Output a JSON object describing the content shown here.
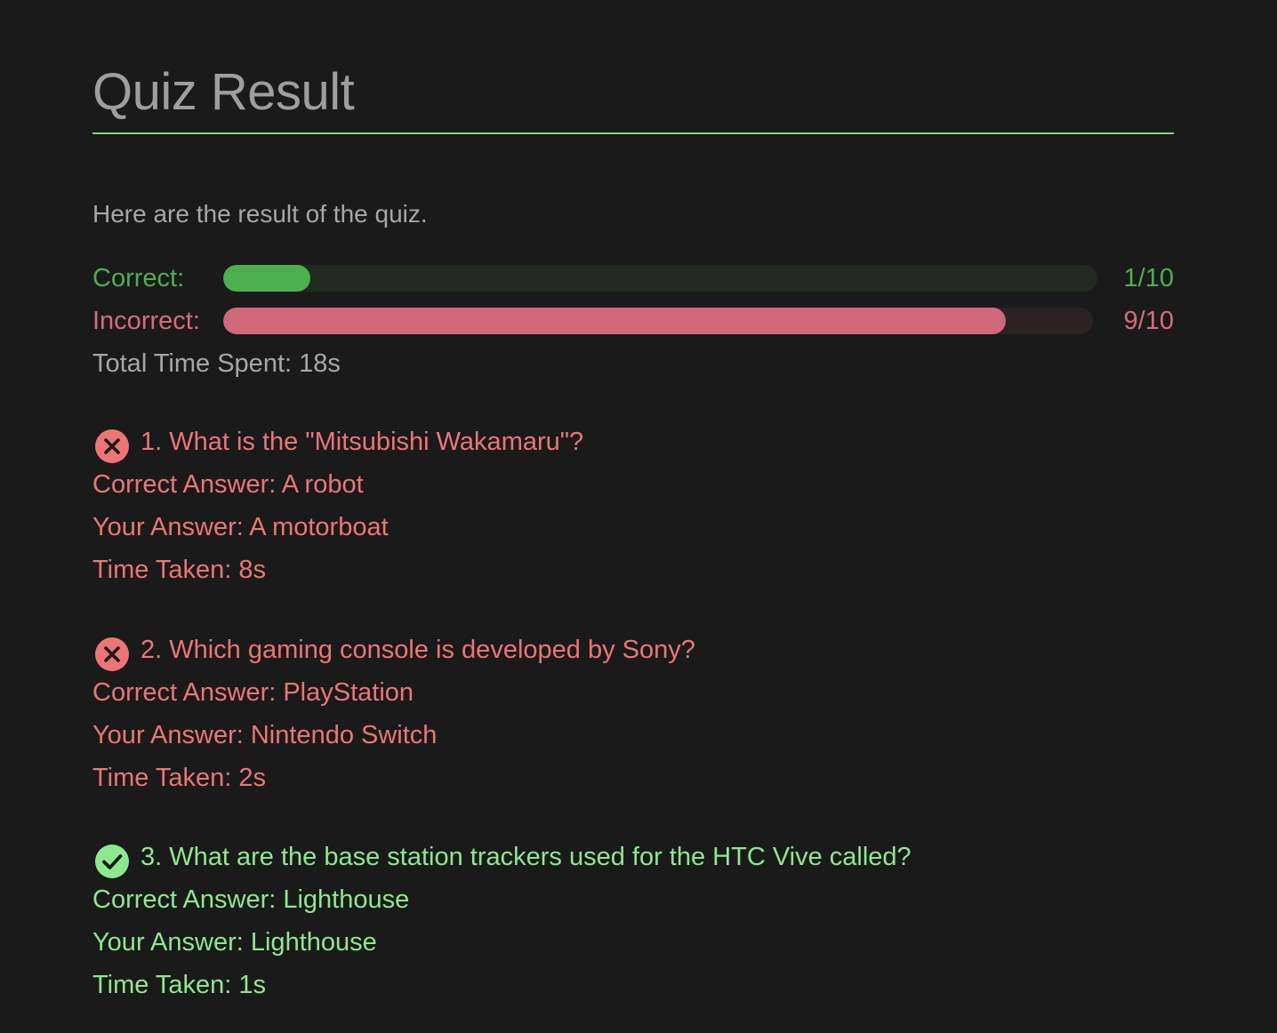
{
  "page": {
    "title": "Quiz Result",
    "intro": "Here are the result of the quiz."
  },
  "stats": {
    "correct": {
      "label": "Correct:",
      "display": "1/10",
      "fraction": 0.1,
      "color": "#4caf50"
    },
    "incorrect": {
      "label": "Incorrect:",
      "display": "9/10",
      "fraction": 0.9,
      "color": "#d0687a"
    },
    "total_time": "Total Time Spent: 18s"
  },
  "questions": [
    {
      "status": "incorrect",
      "icon": "x-circle-icon",
      "question": "1. What is the \"Mitsubishi Wakamaru\"?",
      "correct_answer": "Correct Answer: A robot",
      "your_answer": "Your Answer: A motorboat",
      "time_taken": "Time Taken: 8s"
    },
    {
      "status": "incorrect",
      "icon": "x-circle-icon",
      "question": "2. Which gaming console is developed by Sony?",
      "correct_answer": "Correct Answer: PlayStation",
      "your_answer": "Your Answer: Nintendo Switch",
      "time_taken": "Time Taken: 2s"
    },
    {
      "status": "correct",
      "icon": "check-circle-icon",
      "question": "3. What are the base station trackers used for the HTC Vive called?",
      "correct_answer": "Correct Answer: Lighthouse",
      "your_answer": "Your Answer: Lighthouse",
      "time_taken": "Time Taken: 1s"
    }
  ],
  "colors": {
    "background": "#1a1a1a",
    "accent_green": "#7ed87e",
    "wrong_text": "#ec7575",
    "right_text": "#8ee88e"
  }
}
